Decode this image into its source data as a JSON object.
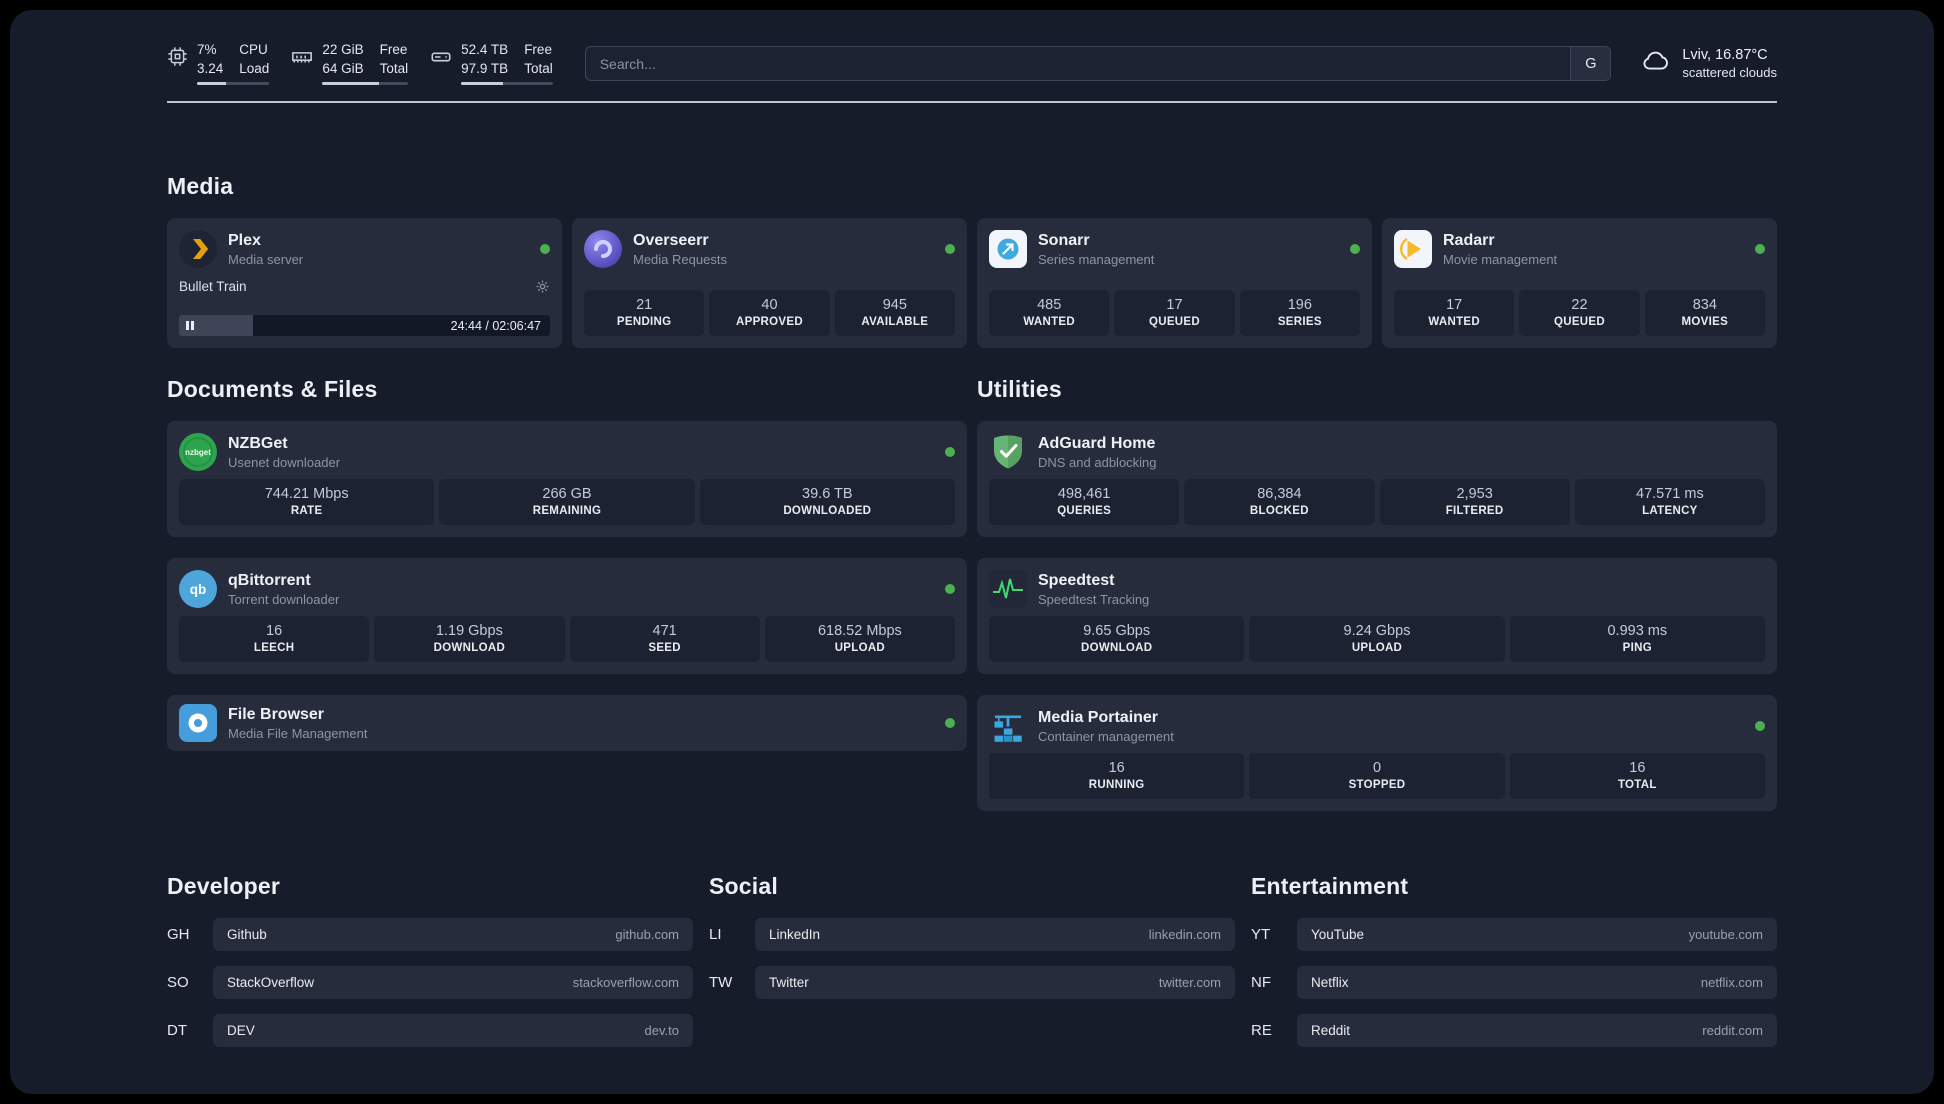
{
  "topbar": {
    "cpu": {
      "icon": "cpu-icon",
      "value1": "7%",
      "value2": "3.24",
      "label1": "CPU",
      "label2": "Load",
      "bar_percent": 40
    },
    "ram": {
      "icon": "ram-icon",
      "value1": "22 GiB",
      "value2": "64 GiB",
      "label1": "Free",
      "label2": "Total",
      "bar_percent": 66
    },
    "disk": {
      "icon": "disk-icon",
      "value1": "52.4 TB",
      "value2": "97.9 TB",
      "label1": "Free",
      "label2": "Total",
      "bar_percent": 46
    },
    "search": {
      "placeholder": "Search...",
      "button_label": "G"
    },
    "weather": {
      "icon": "cloud-icon",
      "location": "Lviv, 16.87°C",
      "condition": "scattered clouds"
    }
  },
  "sections": {
    "media": {
      "title": "Media",
      "apps": [
        {
          "name": "Plex",
          "subtitle": "Media server",
          "icon": "plex-icon",
          "status": "online",
          "player": {
            "title": "Bullet Train",
            "time": "24:44 / 02:06:47",
            "progress_percent": 20
          }
        },
        {
          "name": "Overseerr",
          "subtitle": "Media Requests",
          "icon": "overseerr-icon",
          "status": "online",
          "stats": [
            {
              "value": "21",
              "label": "PENDING"
            },
            {
              "value": "40",
              "label": "APPROVED"
            },
            {
              "value": "945",
              "label": "AVAILABLE"
            }
          ]
        },
        {
          "name": "Sonarr",
          "subtitle": "Series management",
          "icon": "sonarr-icon",
          "status": "online",
          "stats": [
            {
              "value": "485",
              "label": "WANTED"
            },
            {
              "value": "17",
              "label": "QUEUED"
            },
            {
              "value": "196",
              "label": "SERIES"
            }
          ]
        },
        {
          "name": "Radarr",
          "subtitle": "Movie management",
          "icon": "radarr-icon",
          "status": "online",
          "stats": [
            {
              "value": "17",
              "label": "WANTED"
            },
            {
              "value": "22",
              "label": "QUEUED"
            },
            {
              "value": "834",
              "label": "MOVIES"
            }
          ]
        }
      ]
    },
    "documents": {
      "title": "Documents & Files",
      "apps": [
        {
          "name": "NZBGet",
          "subtitle": "Usenet downloader",
          "icon": "nzbget-icon",
          "status": "online",
          "stats": [
            {
              "value": "744.21 Mbps",
              "label": "RATE"
            },
            {
              "value": "266 GB",
              "label": "REMAINING"
            },
            {
              "value": "39.6 TB",
              "label": "DOWNLOADED"
            }
          ]
        },
        {
          "name": "qBittorrent",
          "subtitle": "Torrent downloader",
          "icon": "qbittorrent-icon",
          "status": "online",
          "stats": [
            {
              "value": "16",
              "label": "LEECH"
            },
            {
              "value": "1.19 Gbps",
              "label": "DOWNLOAD"
            },
            {
              "value": "471",
              "label": "SEED"
            },
            {
              "value": "618.52 Mbps",
              "label": "UPLOAD"
            }
          ]
        },
        {
          "name": "File Browser",
          "subtitle": "Media File Management",
          "icon": "filebrowser-icon",
          "status": "online"
        }
      ]
    },
    "utilities": {
      "title": "Utilities",
      "apps": [
        {
          "name": "AdGuard Home",
          "subtitle": "DNS and adblocking",
          "icon": "adguard-icon",
          "stats": [
            {
              "value": "498,461",
              "label": "QUERIES"
            },
            {
              "value": "86,384",
              "label": "BLOCKED"
            },
            {
              "value": "2,953",
              "label": "FILTERED"
            },
            {
              "value": "47.571 ms",
              "label": "LATENCY"
            }
          ]
        },
        {
          "name": "Speedtest",
          "subtitle": "Speedtest Tracking",
          "icon": "speedtest-icon",
          "stats": [
            {
              "value": "9.65 Gbps",
              "label": "DOWNLOAD"
            },
            {
              "value": "9.24 Gbps",
              "label": "UPLOAD"
            },
            {
              "value": "0.993 ms",
              "label": "PING"
            }
          ]
        },
        {
          "name": "Media Portainer",
          "subtitle": "Container management",
          "icon": "portainer-icon",
          "status": "online",
          "stats": [
            {
              "value": "16",
              "label": "RUNNING"
            },
            {
              "value": "0",
              "label": "STOPPED"
            },
            {
              "value": "16",
              "label": "TOTAL"
            }
          ]
        }
      ]
    },
    "developer": {
      "title": "Developer",
      "bookmarks": [
        {
          "abbr": "GH",
          "name": "Github",
          "url": "github.com"
        },
        {
          "abbr": "SO",
          "name": "StackOverflow",
          "url": "stackoverflow.com"
        },
        {
          "abbr": "DT",
          "name": "DEV",
          "url": "dev.to"
        }
      ]
    },
    "social": {
      "title": "Social",
      "bookmarks": [
        {
          "abbr": "LI",
          "name": "LinkedIn",
          "url": "linkedin.com"
        },
        {
          "abbr": "TW",
          "name": "Twitter",
          "url": "twitter.com"
        }
      ]
    },
    "entertainment": {
      "title": "Entertainment",
      "bookmarks": [
        {
          "abbr": "YT",
          "name": "YouTube",
          "url": "youtube.com"
        },
        {
          "abbr": "NF",
          "name": "Netflix",
          "url": "netflix.com"
        },
        {
          "abbr": "RE",
          "name": "Reddit",
          "url": "reddit.com"
        }
      ]
    }
  },
  "colors": {
    "status_online": "#4caf50",
    "background": "#171c2a",
    "card": "#262c3b",
    "stat_tile": "#1c2231",
    "divider": "#bfc6d0",
    "plex": "#e5a00d",
    "overseerr": "#5a4fd4",
    "sonarr": "#3fa9e0",
    "radarr": "#f9b82a",
    "nzbget": "#2da44e",
    "qbittorrent": "#4da5da",
    "filebrowser": "#459ddb",
    "adguard": "#66b574",
    "speedtest": "#40d96e",
    "portainer": "#3aa7de"
  }
}
